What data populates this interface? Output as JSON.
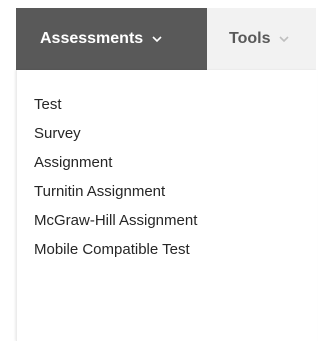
{
  "menubar": {
    "tabs": [
      {
        "label": "Assessments",
        "icon": "chevron-down-icon",
        "active": true
      },
      {
        "label": "Tools",
        "icon": "chevron-down-icon",
        "active": false
      }
    ]
  },
  "dropdown": {
    "items": [
      {
        "label": "Test"
      },
      {
        "label": "Survey"
      },
      {
        "label": "Assignment"
      },
      {
        "label": "Turnitin Assignment"
      },
      {
        "label": "McGraw-Hill Assignment"
      },
      {
        "label": "Mobile Compatible Test"
      }
    ]
  },
  "colors": {
    "active_tab_bg": "#595959",
    "inactive_tab_bg": "#f2f2f2",
    "inactive_tab_text": "#595959",
    "item_text": "#262626"
  }
}
